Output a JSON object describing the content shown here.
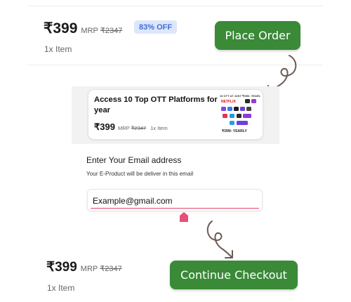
{
  "top_summary": {
    "price": "₹399",
    "mrp_label": "MRP",
    "mrp_value": "₹2347",
    "discount_badge": "83% OFF",
    "quantity": "1x Item",
    "button_label": "Place Order"
  },
  "product_card": {
    "title": "Access 10 Top OTT Platforms for year",
    "price": "₹399",
    "mrp_label": "MRP",
    "mrp_value": "₹2347",
    "quantity": "1x Item",
    "thumbnail": {
      "headline": "10 OTT AT JUST ₹399/- YEARLY",
      "brand": "NETFLIX",
      "footer": "₹399/- YEARLY"
    }
  },
  "email_form": {
    "heading": "Enter Your Email address",
    "subtext": "Your E-Product will be deliver in this email",
    "value": "Example@gmail.com"
  },
  "bottom_summary": {
    "price": "₹399",
    "mrp_label": "MRP",
    "mrp_value": "₹2347",
    "quantity": "1x Item",
    "button_label": "Continue Checkout"
  },
  "colors": {
    "button_green": "#3a8a38",
    "badge_bg": "#dce7fb",
    "badge_text": "#3f6fd8",
    "input_underline": "#e0476f",
    "cursor_marker": "#e84f78"
  },
  "icons": [
    "curly-arrow-down-icon",
    "home-marker-icon"
  ]
}
